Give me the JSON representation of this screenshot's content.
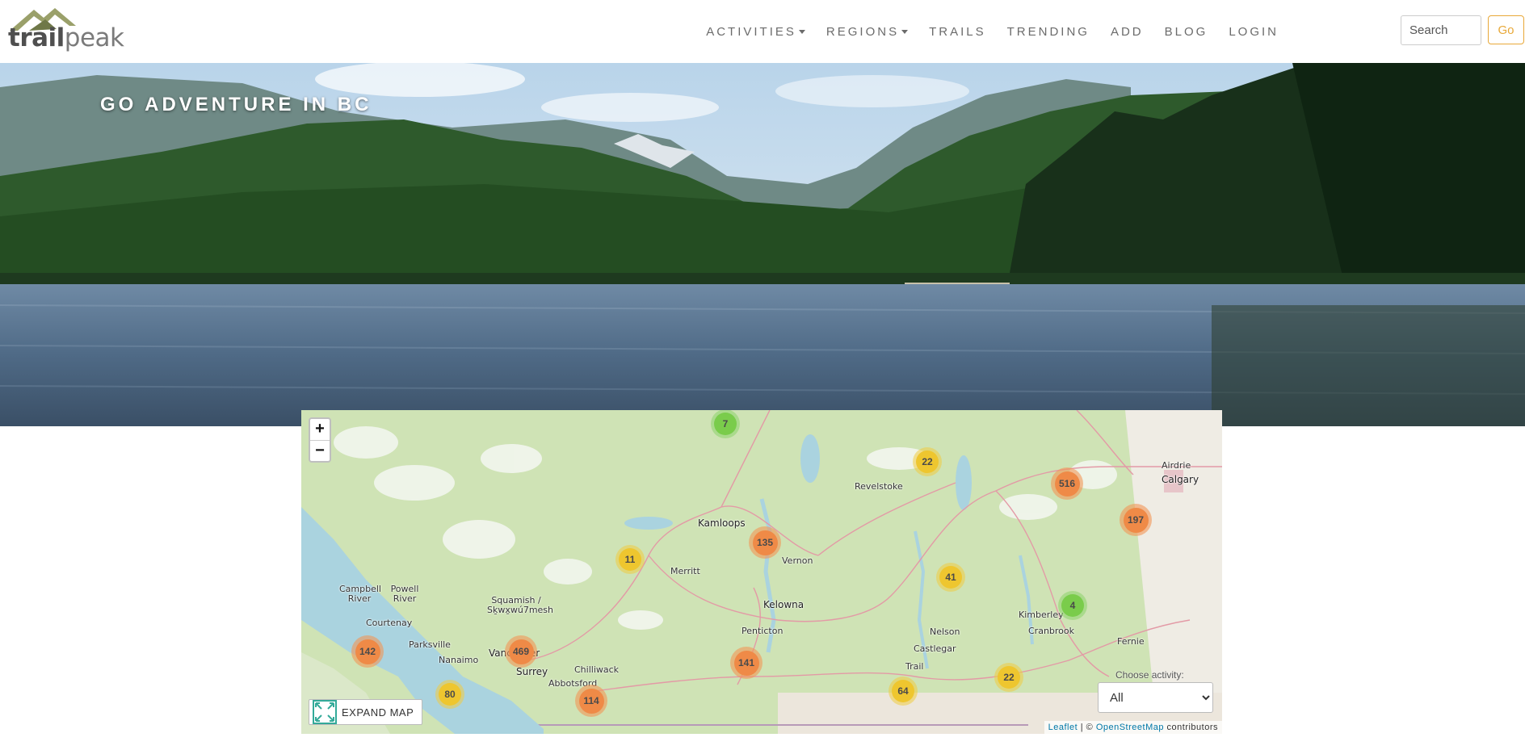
{
  "header": {
    "logo": {
      "part1": "trail",
      "part2": "peak"
    },
    "nav": [
      {
        "label": "ACTIVITIES",
        "dropdown": true
      },
      {
        "label": "REGIONS",
        "dropdown": true
      },
      {
        "label": "TRAILS",
        "dropdown": false
      },
      {
        "label": "TRENDING",
        "dropdown": false
      },
      {
        "label": "ADD",
        "dropdown": false
      },
      {
        "label": "BLOG",
        "dropdown": false
      },
      {
        "label": "LOGIN",
        "dropdown": false
      }
    ],
    "search": {
      "placeholder": "Search",
      "value": ""
    },
    "go_label": "Go"
  },
  "hero": {
    "title": "GO ADVENTURE IN BC"
  },
  "map": {
    "zoom_in": "+",
    "zoom_out": "−",
    "expand_label": "EXPAND MAP",
    "choose_activity_label": "Choose activity:",
    "activity_selected": "All",
    "activity_options": [
      "All"
    ],
    "attribution": {
      "leaflet": "Leaflet",
      "sep": " | © ",
      "osm": "OpenStreetMap",
      "tail": " contributors"
    },
    "clusters": [
      {
        "count": "7",
        "level": "green"
      },
      {
        "count": "22",
        "level": "yellow"
      },
      {
        "count": "516",
        "level": "orange"
      },
      {
        "count": "197",
        "level": "orange"
      },
      {
        "count": "135",
        "level": "orange"
      },
      {
        "count": "11",
        "level": "yellow"
      },
      {
        "count": "41",
        "level": "yellow"
      },
      {
        "count": "4",
        "level": "green"
      },
      {
        "count": "142",
        "level": "orange"
      },
      {
        "count": "469",
        "level": "orange"
      },
      {
        "count": "141",
        "level": "orange"
      },
      {
        "count": "22",
        "level": "yellow"
      },
      {
        "count": "80",
        "level": "yellow"
      },
      {
        "count": "64",
        "level": "yellow"
      },
      {
        "count": "114",
        "level": "orange"
      }
    ],
    "places": [
      "Airdrie",
      "Calgary",
      "Revelstoke",
      "Kamloops",
      "Vernon",
      "Merritt",
      "Kelowna",
      "Penticton",
      "Nelson",
      "Castlegar",
      "Trail",
      "Kimberley",
      "Cranbrook",
      "Fernie",
      "Campbell River",
      "Powell River",
      "Squamish / Sḵwx̱wú7mesh",
      "Parksville",
      "Vancouver",
      "Surrey",
      "Abbotsford",
      "Chilliwack",
      "Nanaimo",
      "Courtenay"
    ]
  },
  "colors": {
    "accent": "#e8a838",
    "nav_text": "#6b6b6b",
    "map_land": "#cfe3b5"
  }
}
